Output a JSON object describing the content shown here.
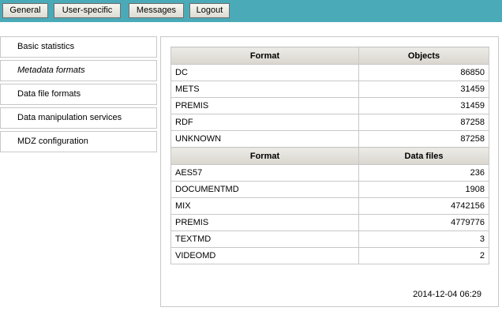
{
  "topnav": {
    "buttons": [
      {
        "label": "General"
      },
      {
        "label": "User-specific"
      },
      {
        "label": "Messages"
      },
      {
        "label": "Logout"
      }
    ]
  },
  "sidebar": {
    "items": [
      {
        "label": "Basic statistics"
      },
      {
        "label": "Metadata formats"
      },
      {
        "label": "Data file formats"
      },
      {
        "label": "Data manipulation services"
      },
      {
        "label": "MDZ configuration"
      }
    ],
    "active_index": 1
  },
  "objects_table": {
    "headers": [
      "Format",
      "Objects"
    ],
    "rows": [
      {
        "format": "DC",
        "count": "86850"
      },
      {
        "format": "METS",
        "count": "31459"
      },
      {
        "format": "PREMIS",
        "count": "31459"
      },
      {
        "format": "RDF",
        "count": "87258"
      },
      {
        "format": "UNKNOWN",
        "count": "87258"
      }
    ]
  },
  "datafiles_table": {
    "headers": [
      "Format",
      "Data files"
    ],
    "rows": [
      {
        "format": "AES57",
        "count": "236"
      },
      {
        "format": "DOCUMENTMD",
        "count": "1908"
      },
      {
        "format": "MIX",
        "count": "4742156"
      },
      {
        "format": "PREMIS",
        "count": "4779776"
      },
      {
        "format": "TEXTMD",
        "count": "3"
      },
      {
        "format": "VIDEOMD",
        "count": "2"
      }
    ]
  },
  "timestamp": "2014-12-04 06:29",
  "colors": {
    "topbar": "#4aaab8",
    "border": "#c8c8c8"
  }
}
